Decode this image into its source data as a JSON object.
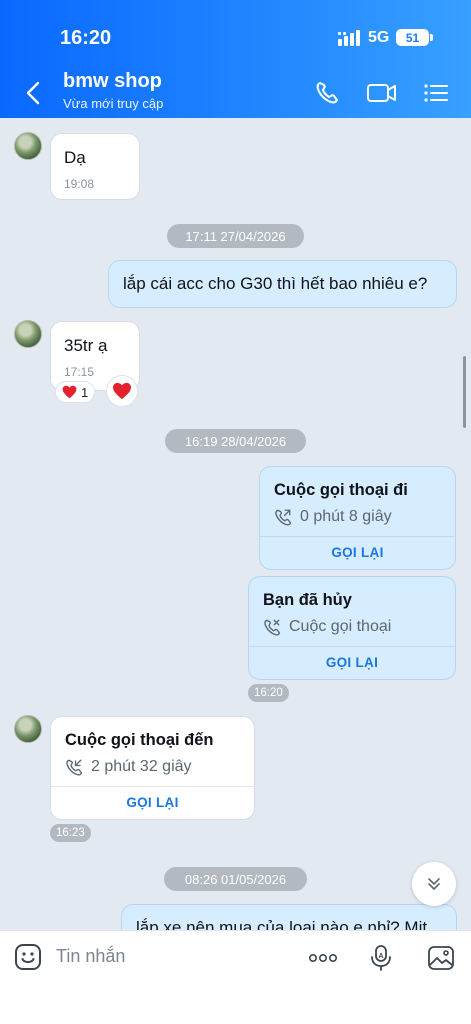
{
  "status": {
    "time": "16:20",
    "network": "5G",
    "battery": "51"
  },
  "header": {
    "title": "bmw shop",
    "subtitle": "Vừa mới truy cập"
  },
  "messages": {
    "m1": {
      "text": "Dạ",
      "time": "19:08"
    },
    "date1": "17:11 27/04/2026",
    "m2": {
      "text": "lắp cái acc cho G30 thì hết bao nhiêu e?"
    },
    "m3": {
      "text": "35tr ạ",
      "time": "17:15",
      "reaction_count": "1"
    },
    "date2": "16:19 28/04/2026",
    "call1": {
      "title": "Cuộc gọi thoại đi",
      "detail": "0 phút 8 giây",
      "action": "GỌI LẠI"
    },
    "call2": {
      "title": "Bạn đã hủy",
      "detail": "Cuộc gọi thoại",
      "action": "GỌI LẠI",
      "time": "16:20"
    },
    "call3": {
      "title": "Cuộc gọi thoại đến",
      "detail": "2 phút 32 giây",
      "action": "GỌI LẠI",
      "time": "16:23"
    },
    "date3": "08:26 01/05/2026",
    "m4": {
      "text": "lắp xe nên mua của loại nào e nhỉ? Mit"
    }
  },
  "input": {
    "placeholder": "Tin nhắn"
  },
  "colors": {
    "header_start": "#0a68ff",
    "header_end": "#38a0ff",
    "my_bubble": "#d6ecff",
    "accent": "#1a76e0"
  }
}
